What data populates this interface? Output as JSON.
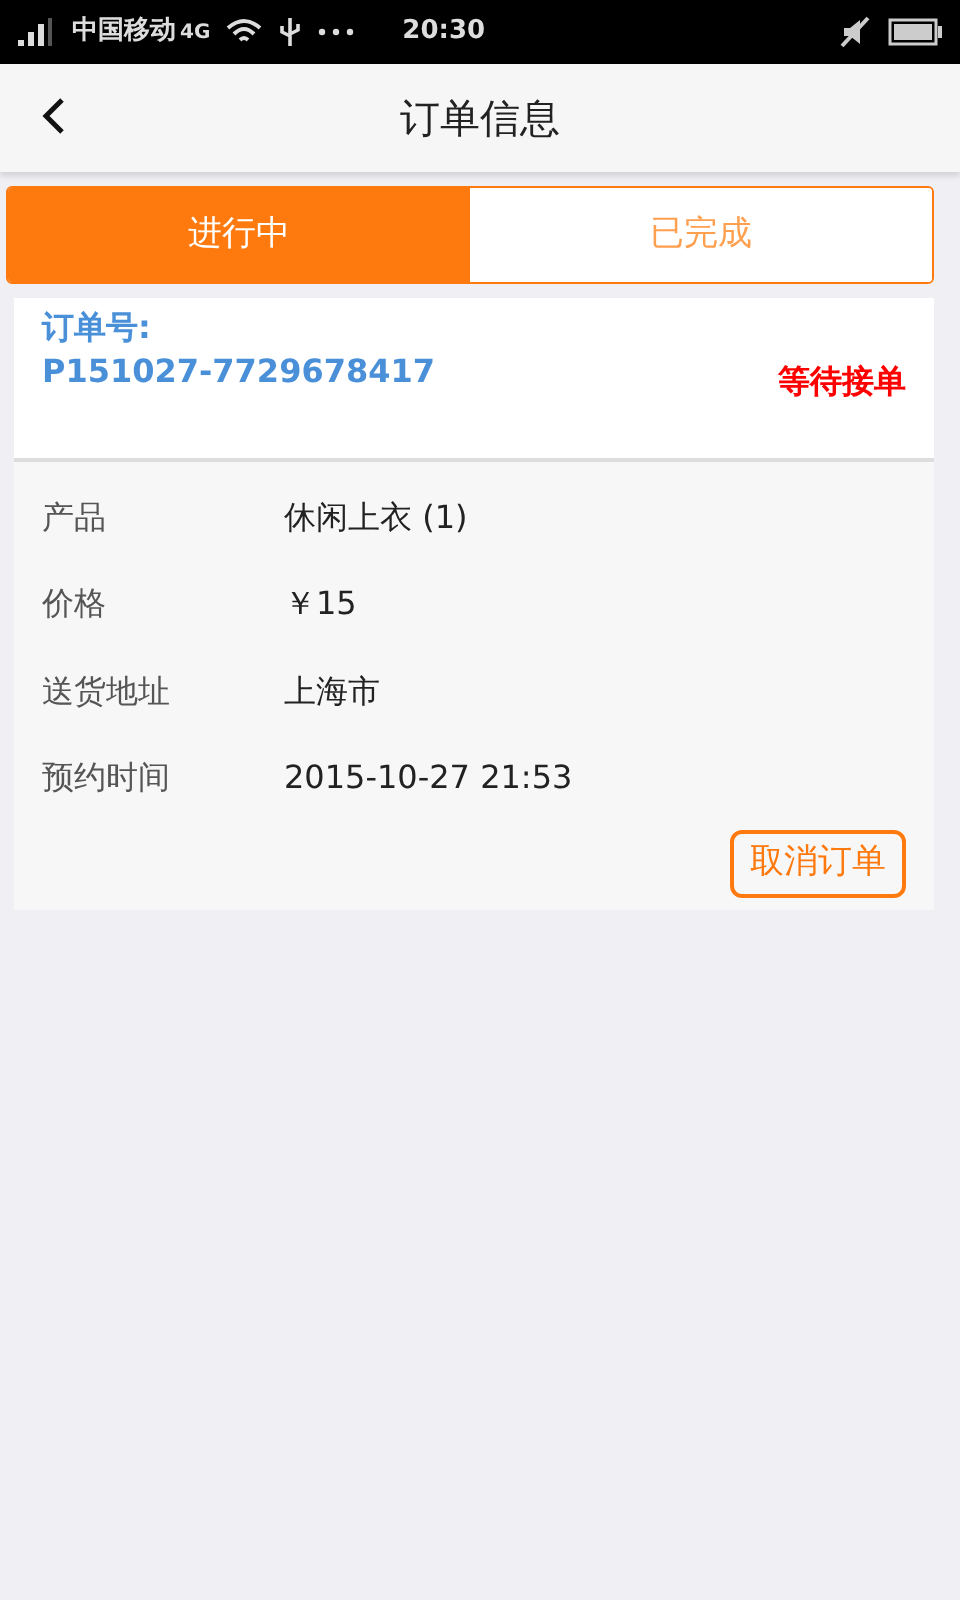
{
  "status_bar": {
    "carrier": "中国移动",
    "network": "4G",
    "time": "20:30"
  },
  "header": {
    "title": "订单信息"
  },
  "tabs": [
    {
      "label": "进行中",
      "selected": true
    },
    {
      "label": "已完成",
      "selected": false
    }
  ],
  "order": {
    "number_label": "订单号:",
    "number": "P151027-7729678417",
    "status": "等待接单",
    "details": [
      {
        "label": "产品",
        "value": "休闲上衣 (1)"
      },
      {
        "label": "价格",
        "value": "￥15"
      },
      {
        "label": "送货地址",
        "value": "上海市"
      },
      {
        "label": "预约时间",
        "value": "2015-10-27 21:53"
      }
    ],
    "action": "取消订单"
  }
}
